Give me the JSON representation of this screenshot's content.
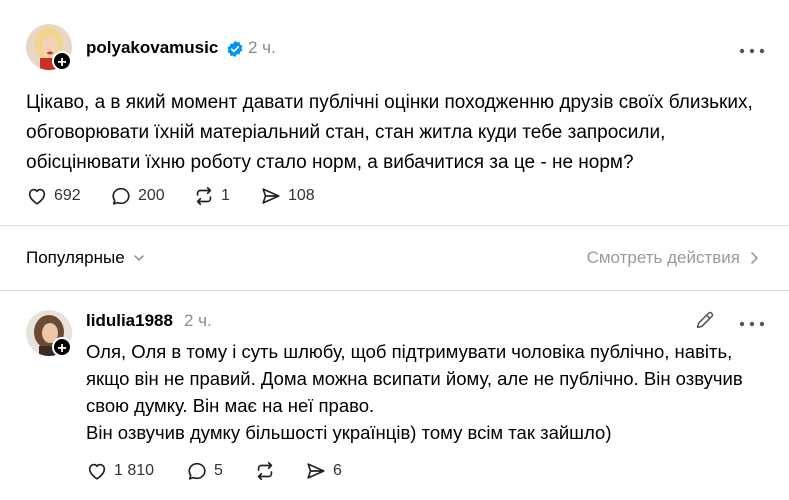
{
  "main_post": {
    "username": "polyakovamusic",
    "verified": true,
    "timestamp": "2 ч.",
    "text_lines": [
      "Цікаво, а в який момент давати публічні оцінки походженню друзів своїх близьких,",
      "обговорювати їхній матеріальний стан, стан житла куди тебе запросили,",
      "обісцінювати їхню роботу стало норм, а вибачитися за це - не норм?"
    ],
    "likes": "692",
    "comments": "200",
    "reposts": "1",
    "shares": "108"
  },
  "sort_bar": {
    "sort_label": "Популярные",
    "view_activity": "Смотреть действия"
  },
  "reply": {
    "username": "lidulia1988",
    "timestamp": "2 ч.",
    "text_lines": [
      "Оля, Оля в тому і суть шлюбу, щоб підтримувати чоловіка публічно, навіть,",
      "якщо він не правий. Дома можна всипати йому, але не публічно. Він озвучив",
      "свою думку. Він має на неї право.",
      "Він озвучив думку більшості українців) тому всім так зайшло)"
    ],
    "likes": "1 810",
    "comments": "5",
    "shares": "6"
  },
  "colors": {
    "verified_blue": "#0095f6",
    "muted_text": "#8a8a8a",
    "divider": "#dcdcdc"
  }
}
